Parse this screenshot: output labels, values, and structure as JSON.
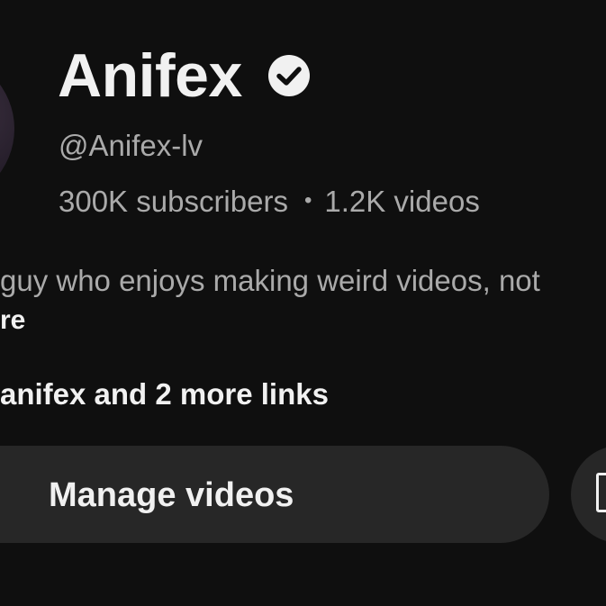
{
  "channel": {
    "name": "Anifex",
    "verified_icon": "verified-check-icon",
    "handle": "@Anifex-lv",
    "subscribers": "300K subscribers",
    "separator": "•",
    "videos": "1.2K videos"
  },
  "about": {
    "description": "guy who enjoys making weird videos, not",
    "more_label": "re"
  },
  "links": {
    "label": "anifex and 2 more links"
  },
  "actions": {
    "manage_videos_label": "Manage videos",
    "secondary_icon": "square-outline-icon"
  },
  "colors": {
    "background": "#0f0f0f",
    "primary_text": "#f1f1f1",
    "secondary_text": "#aaaaaa",
    "button_bg": "#272727"
  }
}
